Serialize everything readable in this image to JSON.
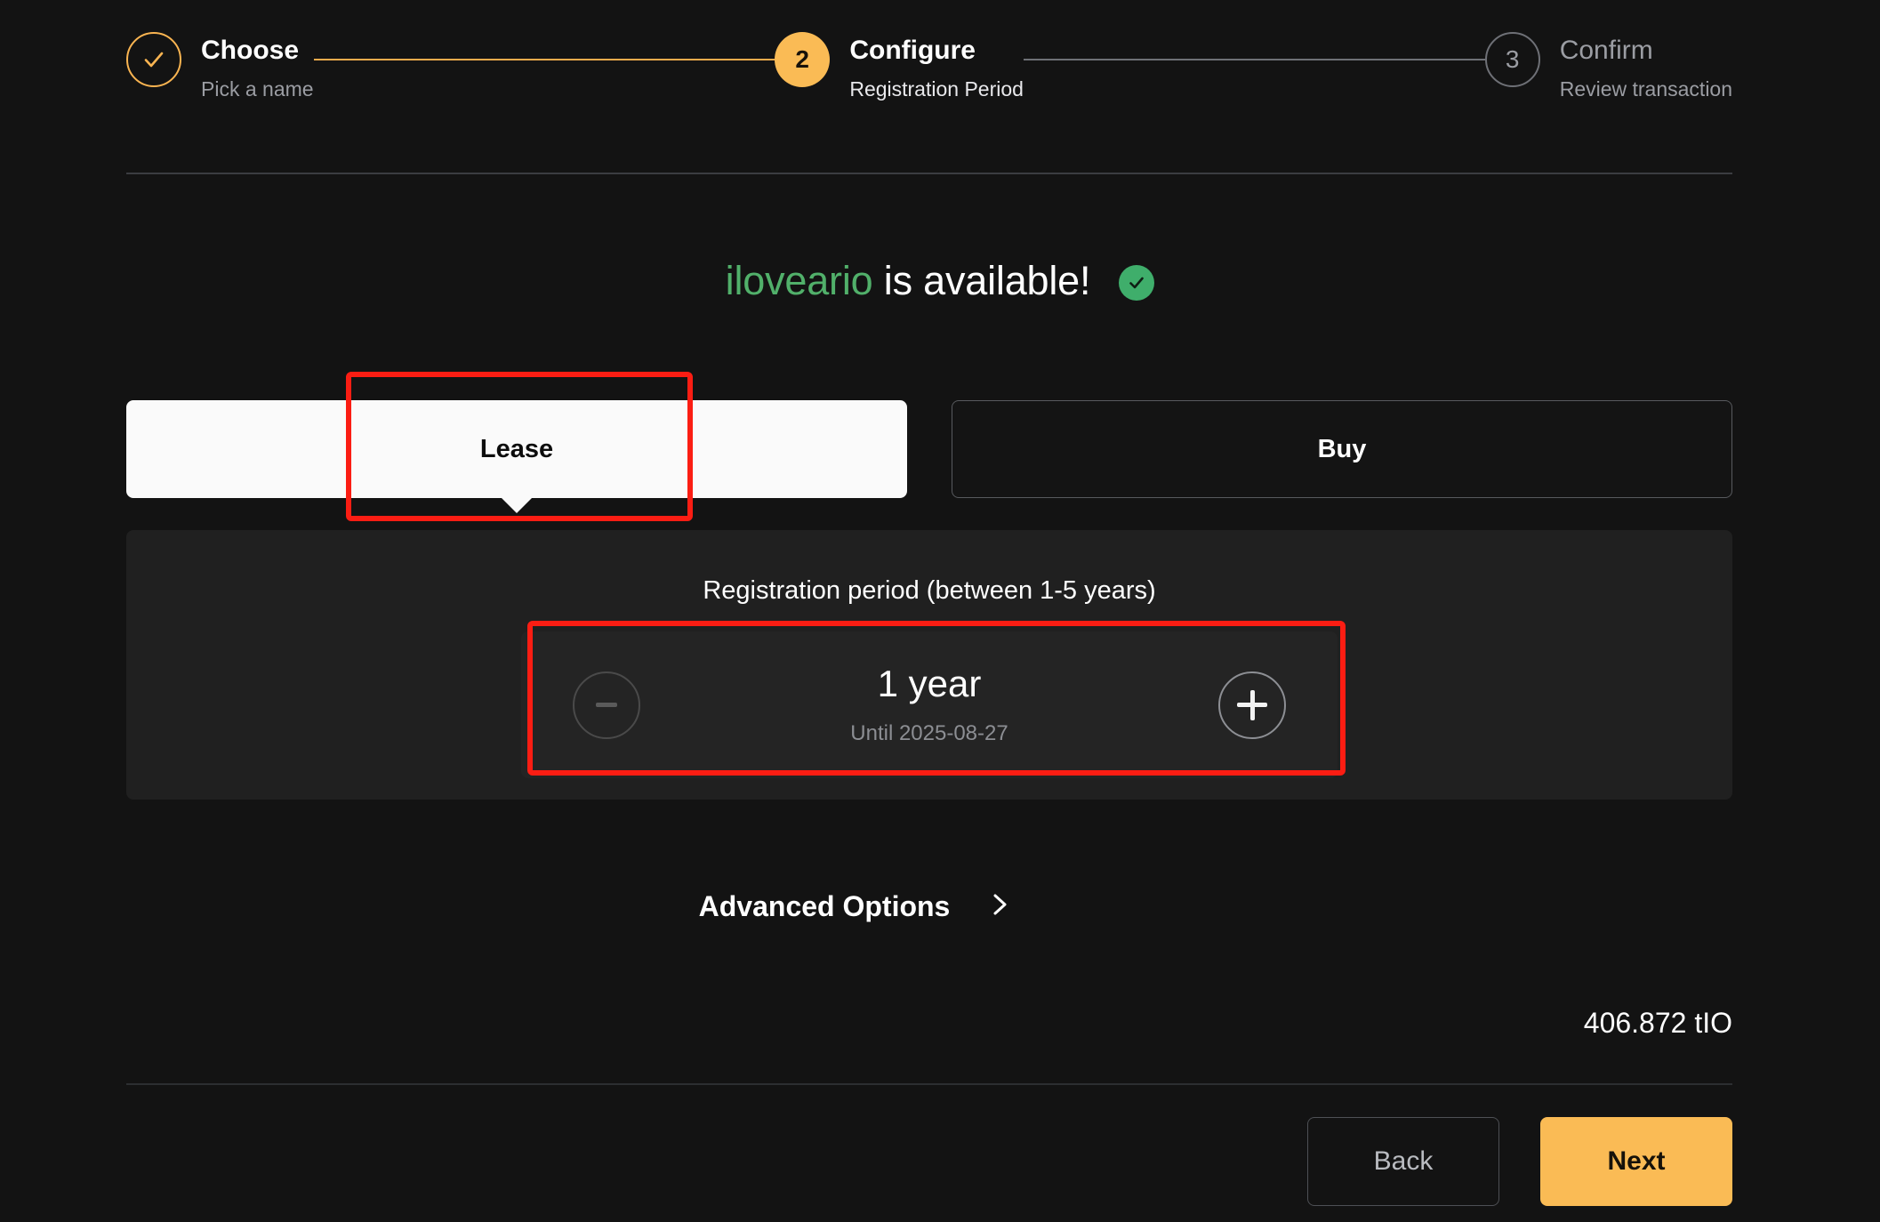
{
  "stepper": {
    "steps": [
      {
        "marker": "check",
        "title": "Choose",
        "subtitle": "Pick a name",
        "state": "done"
      },
      {
        "marker": "2",
        "title": "Configure",
        "subtitle": "Registration Period",
        "state": "current"
      },
      {
        "marker": "3",
        "title": "Confirm",
        "subtitle": "Review transaction",
        "state": "pending"
      }
    ],
    "connector_left_color": "#f0ab4c",
    "connector_right_color": "#6e7076"
  },
  "availability": {
    "name": "iloveario",
    "message": "is available!",
    "name_color": "#51b06a",
    "check_icon": "check-circle-icon",
    "check_color": "#3fae6b"
  },
  "tabs": {
    "lease_label": "Lease",
    "buy_label": "Buy",
    "selected": "Lease"
  },
  "period": {
    "label": "Registration period (between 1-5 years)",
    "value": "1 year",
    "until": "Until 2025-08-27",
    "decrement_icon": "minus-icon",
    "increment_icon": "plus-icon",
    "decrement_enabled": false,
    "increment_enabled": true
  },
  "advanced": {
    "label": "Advanced Options",
    "icon": "chevron-right-icon"
  },
  "price": {
    "amount": "406.872",
    "ticker": "tIO",
    "display": "406.872 tIO"
  },
  "footer": {
    "back_label": "Back",
    "next_label": "Next",
    "next_color": "#fabb55"
  },
  "annotations": {
    "lease_highlight": "lease-tab",
    "stepper_highlight": "registration-period-stepper",
    "color": "#fb1d13"
  }
}
